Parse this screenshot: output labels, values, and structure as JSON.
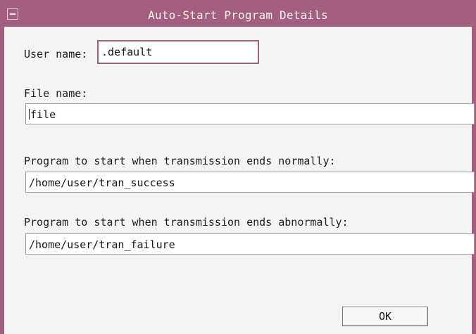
{
  "window": {
    "title": "Auto-Start Program Details"
  },
  "fields": {
    "user_name": {
      "label": "User name:",
      "value": ".default"
    },
    "file_name": {
      "label": "File name:",
      "value": "file"
    },
    "normal_program": {
      "label": "Program to start when transmission ends normally:",
      "value": "/home/user/tran_success"
    },
    "abnormal_program": {
      "label": "Program to start when transmission ends abnormally:",
      "value": "/home/user/tran_failure"
    }
  },
  "buttons": {
    "ok_label": "OK"
  },
  "colors": {
    "titlebar": "#a3607e",
    "window_bg": "#f4f4f4",
    "field_bg": "#ffffff"
  },
  "icons": {
    "window_menu": "window-menu-icon"
  }
}
